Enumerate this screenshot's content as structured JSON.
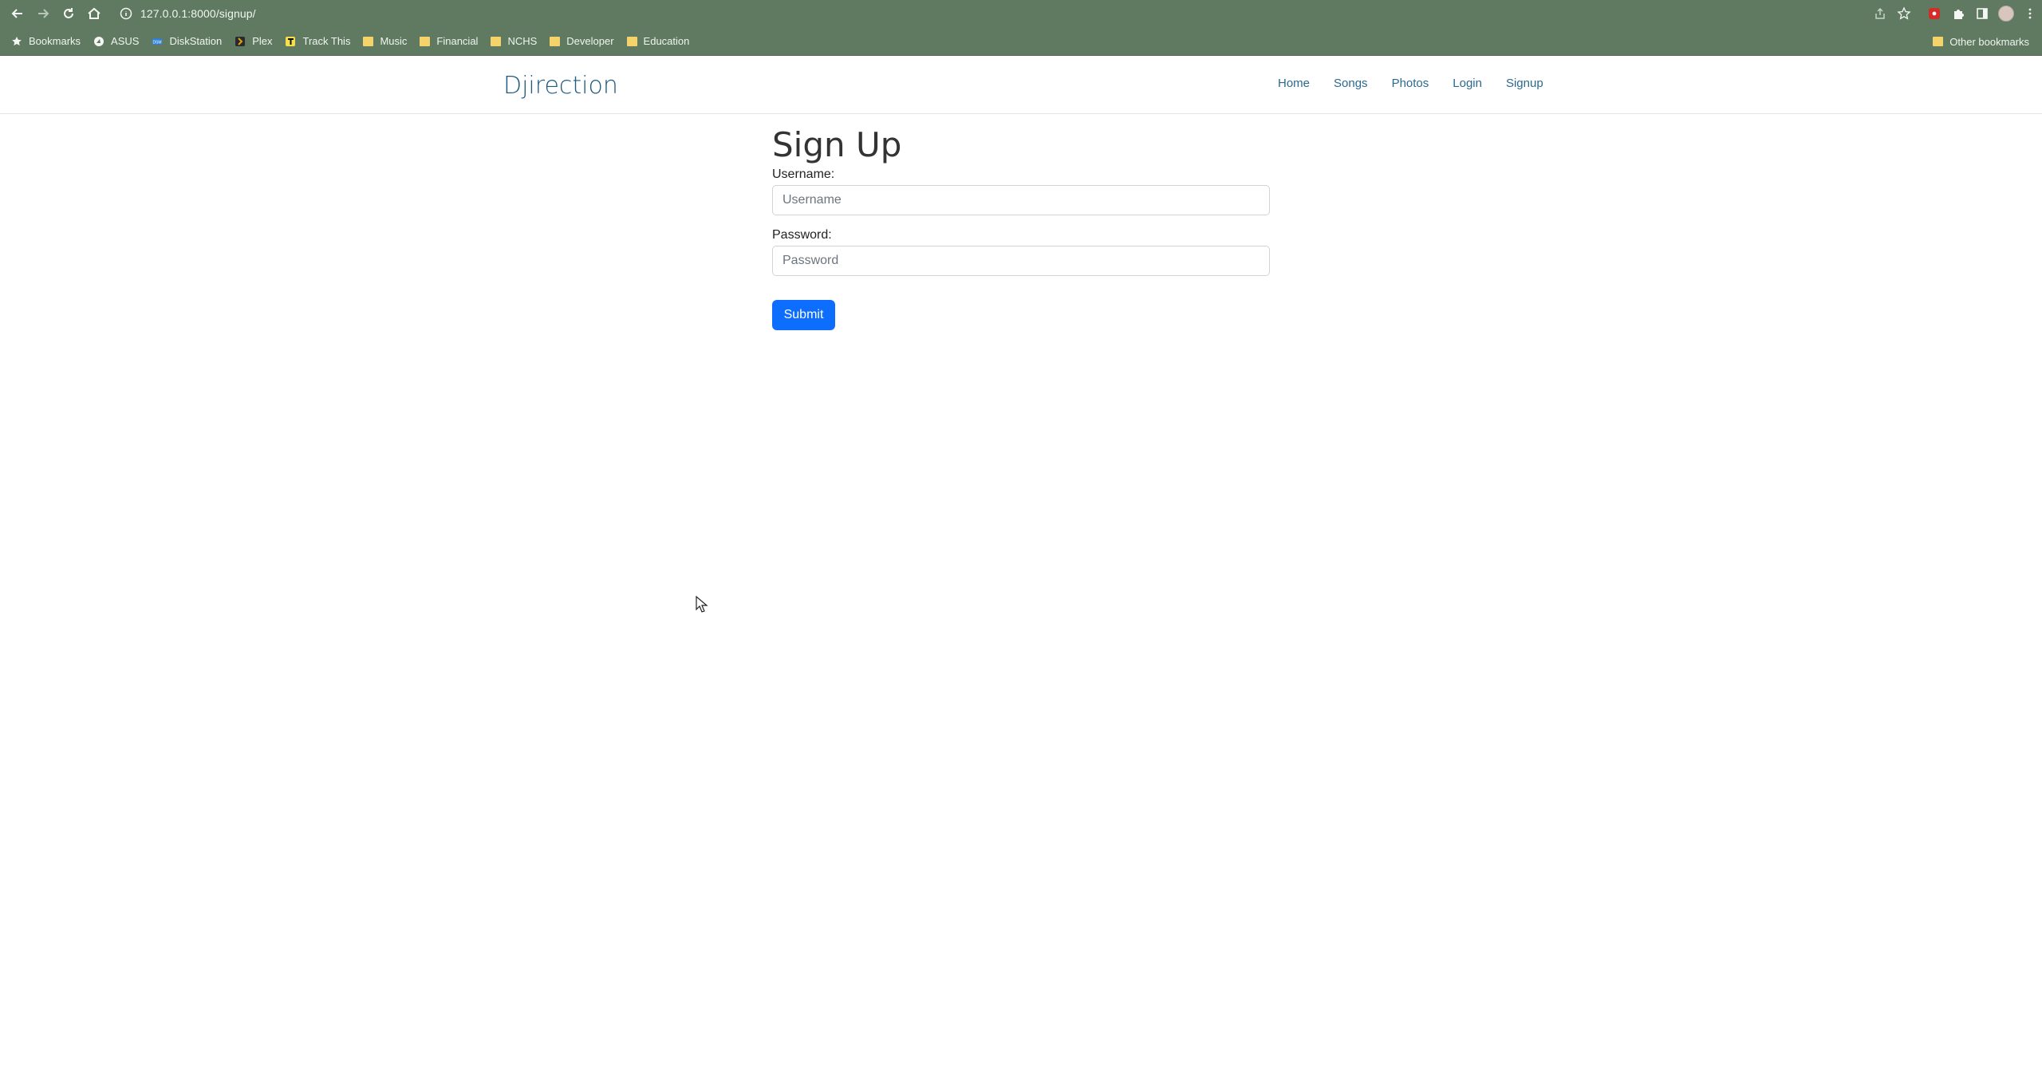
{
  "browser": {
    "url": "127.0.0.1:8000/signup/",
    "bookmarks": [
      {
        "label": "Bookmarks",
        "icon": "star-icon"
      },
      {
        "label": "ASUS",
        "icon": "asus-icon"
      },
      {
        "label": "DiskStation",
        "icon": "dsm-icon"
      },
      {
        "label": "Plex",
        "icon": "plex-icon"
      },
      {
        "label": "Track This",
        "icon": "track-icon"
      },
      {
        "label": "Music",
        "icon": "folder-icon"
      },
      {
        "label": "Financial",
        "icon": "folder-icon"
      },
      {
        "label": "NCHS",
        "icon": "folder-icon"
      },
      {
        "label": "Developer",
        "icon": "folder-icon"
      },
      {
        "label": "Education",
        "icon": "folder-icon"
      }
    ],
    "other_bookmarks": "Other bookmarks"
  },
  "site": {
    "brand": "Djirection",
    "nav": [
      "Home",
      "Songs",
      "Photos",
      "Login",
      "Signup"
    ]
  },
  "form": {
    "title": "Sign Up",
    "username_label": "Username:",
    "username_placeholder": "Username",
    "password_label": "Password:",
    "password_placeholder": "Password",
    "submit_label": "Submit"
  },
  "colors": {
    "chrome": "#5f7a61",
    "brand": "#1f5b7f",
    "primary": "#0d6efd"
  }
}
